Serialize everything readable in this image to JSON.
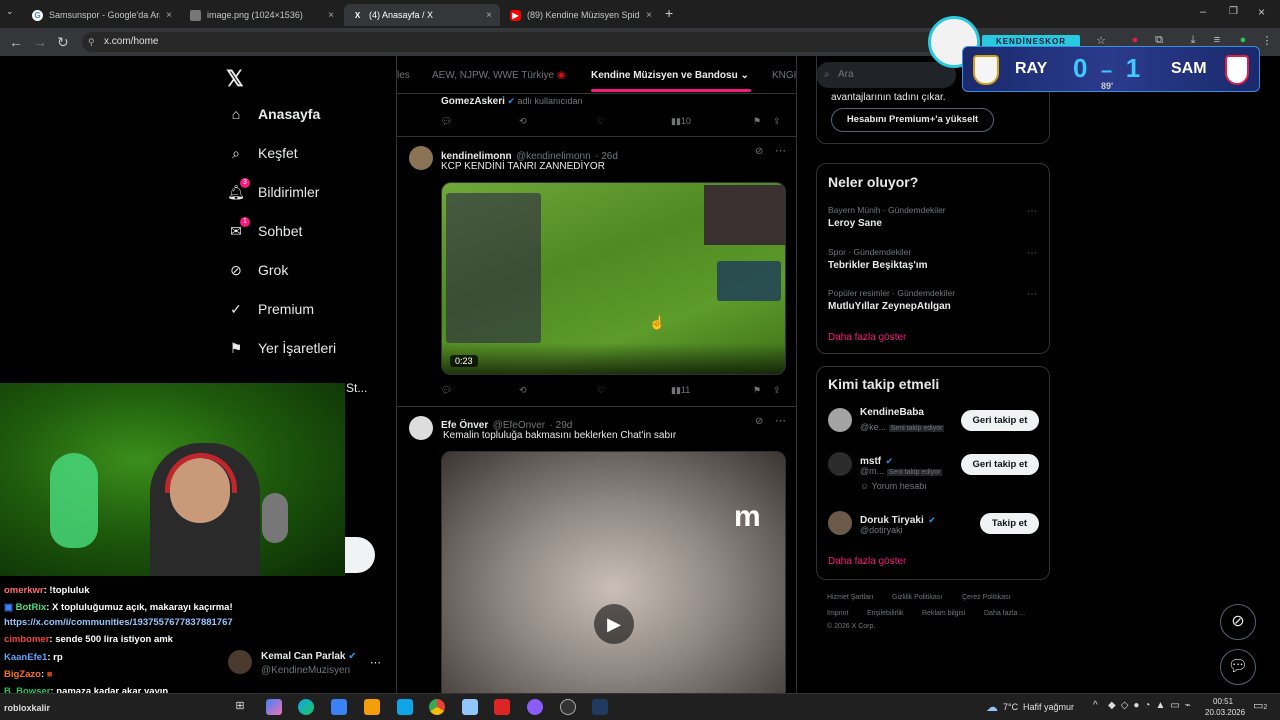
{
  "browser": {
    "tabs": [
      {
        "label": "Samsunspor - Google'da Ara",
        "fav": "G",
        "fav_color": "#4285f4"
      },
      {
        "label": "image.png (1024×1536)",
        "fav": "",
        "fav_color": "#777777"
      },
      {
        "label": "(4) Anasayfa / X",
        "fav": "X",
        "fav_color": "#000000"
      },
      {
        "label": "(89) Kendine Müzisyen Spiderm",
        "fav": "▶",
        "fav_color": "#ff0000"
      }
    ],
    "url": "x.com/home"
  },
  "x": {
    "nav": [
      {
        "label": "Anasayfa",
        "icon": "home-icon",
        "glyph": "⌂"
      },
      {
        "label": "Keşfet",
        "icon": "search-icon",
        "glyph": "⌕"
      },
      {
        "label": "Bildirimler",
        "icon": "bell-icon",
        "glyph": "♫",
        "badge": "3"
      },
      {
        "label": "Sohbet",
        "icon": "mail-icon",
        "glyph": "✉",
        "badge": "1"
      },
      {
        "label": "Grok",
        "icon": "grok-icon",
        "glyph": "⊘"
      },
      {
        "label": "Premium",
        "icon": "premium-icon",
        "glyph": "✓"
      },
      {
        "label": "Yer İşaretleri",
        "icon": "bookmark-icon",
        "glyph": "⚑"
      }
    ],
    "feed_tabs": {
      "left": "les",
      "other": "AEW, NJPW, WWE Türkiye",
      "active": "Kendine Müzisyen ve Bandosu",
      "right": "KNGI"
    },
    "prev_tweet": {
      "name": "GomezAskeri",
      "note": "adlı kullanıcıdan",
      "views": "10"
    },
    "tweet1": {
      "name": "kendinelimonn",
      "handle": "@kendinelimonn",
      "time": "· 26d",
      "text": "KCP KENDİNİ TANRI ZANNEDİYOR",
      "video_time": "0:23",
      "views": "11"
    },
    "tweet2": {
      "name": "Efe Önver",
      "handle": "@EfeOnver",
      "time": "· 29d",
      "text": "Kemalin topluluğa bakmasını beklerken Chat'in sabır",
      "watermark": "m"
    },
    "account": {
      "name": "Kemal Can Parlak",
      "handle": "@KendineMuzisyen"
    },
    "right": {
      "search_placeholder": "Ara",
      "premium_text": "avantajlarının tadını çıkar.",
      "premium_button": "Hesabını Premium+'a yükselt",
      "trends_title": "Neler oluyor?",
      "trends": [
        {
          "meta": "Bayern Münih · Gündemdekiler",
          "name": "Leroy Sane"
        },
        {
          "meta": "Spor · Gündemdekiler",
          "name": "Tebrikler Beşiktaş'ım"
        },
        {
          "meta": "Popüler resimler · Gündemdekiler",
          "name": "MutluYıllar ZeynepAtılgan"
        }
      ],
      "show_more": "Daha fazla göster",
      "follow_title": "Kimi takip etmeli",
      "suggestions": [
        {
          "name": "KendineBaba",
          "handle": "@ke...",
          "follows_you": "Seni takip ediyor",
          "button": "Geri takip et"
        },
        {
          "name": "mstf",
          "handle": "@m...",
          "follows_you": "Seni takip ediyor",
          "sub": "Yorum hesabı",
          "button": "Geri takip et"
        },
        {
          "name": "Doruk Tiryaki",
          "handle": "@dotiryaki",
          "button": "Takip et"
        }
      ],
      "footer": [
        "Hizmet Şartları",
        "Gizlilik Politikası",
        "Çerez Politikası",
        "Imprint",
        "Erişilebilirlik",
        "Reklam bilgisi",
        "Daha fazla ...",
        "© 2026 X Corp."
      ]
    }
  },
  "stream": {
    "overlay_text": "St...",
    "chat": [
      {
        "user": "omerkwr",
        "color": "#ff6b6b",
        "msg": ": !topluluk"
      },
      {
        "user": "BotRix",
        "color": "#4ade80",
        "msg": ": X topluluğumuz açık, makarayı kaçırma!"
      },
      {
        "user": "",
        "color": "#60a5fa",
        "msg": "https://x.com/i/communities/1937557677837881767"
      },
      {
        "user": "cimbomer",
        "color": "#ef4444",
        "msg": ": sende 500 lira istiyon amk"
      },
      {
        "user": "KaanEfe1",
        "color": "#60a5fa",
        "msg": ": rp"
      },
      {
        "user": "BigZazo",
        "color": "#f97316",
        "msg": ":"
      },
      {
        "user": "B_Bowser",
        "color": "#22c55e",
        "msg": ": namaza kadar akar yayın"
      }
    ],
    "chat_bottom": "robloxkalir",
    "scoreboard": {
      "label": "KENDİNESKOR",
      "home": "RAY",
      "away": "SAM",
      "home_score": "0",
      "away_score": "1",
      "minute": "89'"
    }
  },
  "taskbar": {
    "weather_temp": "7°C",
    "weather_text": "Hafif yağmur",
    "time": "00:51",
    "date": "20.03.2026",
    "notif": "2"
  }
}
